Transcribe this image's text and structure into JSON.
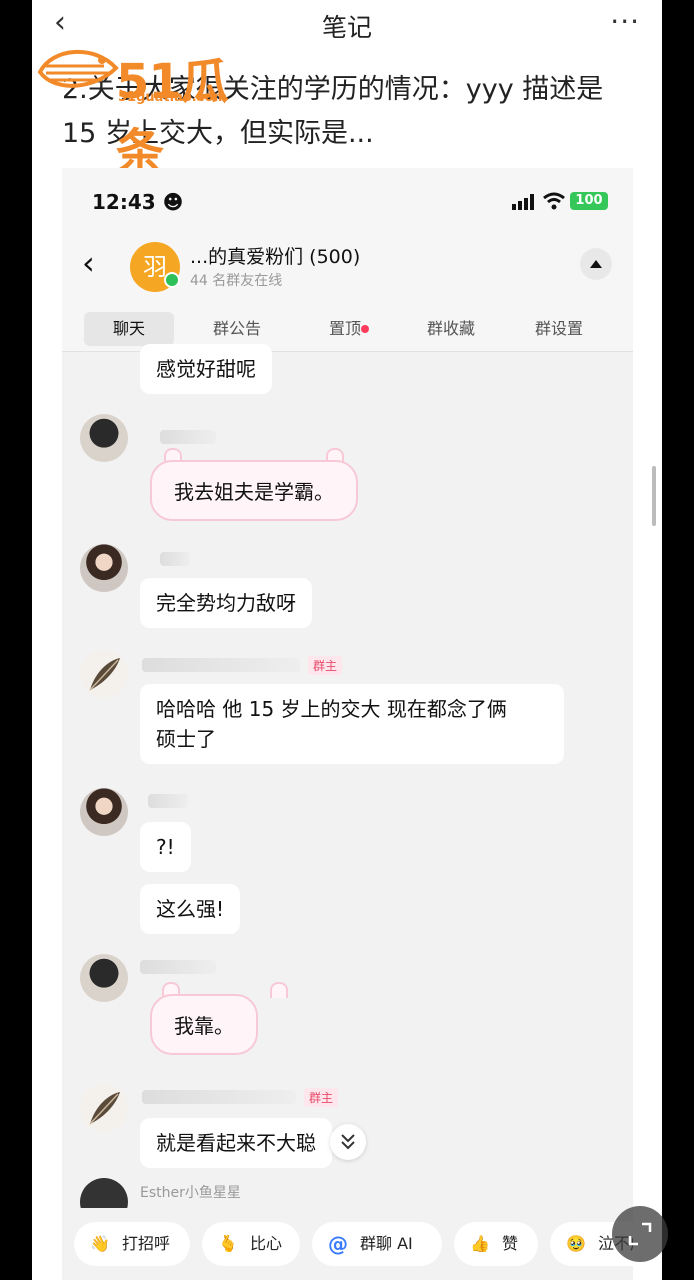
{
  "note": {
    "back_glyph": "‹",
    "title": "笔记",
    "more_glyph": "···",
    "text": "2.关于大家很关注的学历的情况：yyy 描述是 15 岁上交大，但实际是..."
  },
  "watermark": {
    "logo_num": "51瓜条",
    "logo_sub": "51guatiao.com"
  },
  "status_bar": {
    "time": "12:43 ☻",
    "battery": "100"
  },
  "chat_header": {
    "group_avatar_char": "羽",
    "group_name": "...的真爱粉们 (500)",
    "online_count": "44 名群友在线"
  },
  "tabs": [
    {
      "label": "聊天",
      "active": true
    },
    {
      "label": "群公告",
      "active": false
    },
    {
      "label": "置顶",
      "active": false
    },
    {
      "label": "群收藏",
      "active": false
    },
    {
      "label": "群设置",
      "active": false
    }
  ],
  "messages": {
    "m1": {
      "text": "感觉好甜呢"
    },
    "m2": {
      "text": "我去姐夫是学霸。"
    },
    "m3": {
      "text": "完全势均力敌呀"
    },
    "m4": {
      "tag": "群主",
      "text_line1": "哈哈哈 他 15 岁上的交大 现在都念了俩",
      "text_line2": "硕士了"
    },
    "m5": {
      "text": "?!"
    },
    "m6": {
      "text": "这么强!"
    },
    "m7": {
      "text": "我靠。"
    },
    "m8": {
      "tag": "群主",
      "text": "就是看起来不大聪"
    },
    "m9": {
      "name": "Esther小鱼星星"
    }
  },
  "quick_replies": [
    {
      "icon": "wave-emoji",
      "label": "打招呼"
    },
    {
      "icon": "heart-hand-emoji",
      "label": "比心"
    },
    {
      "icon": "at-icon",
      "label": "群聊 AI"
    },
    {
      "icon": "thumbs-up-emoji",
      "label": "赞"
    },
    {
      "icon": "holding-tears-emoji",
      "label": "泣不成"
    }
  ],
  "colors": {
    "accent_orange": "#f28a2a",
    "owner_tag": "#e84a6b",
    "online_green": "#2ec05b",
    "battery_green": "#35c759"
  }
}
